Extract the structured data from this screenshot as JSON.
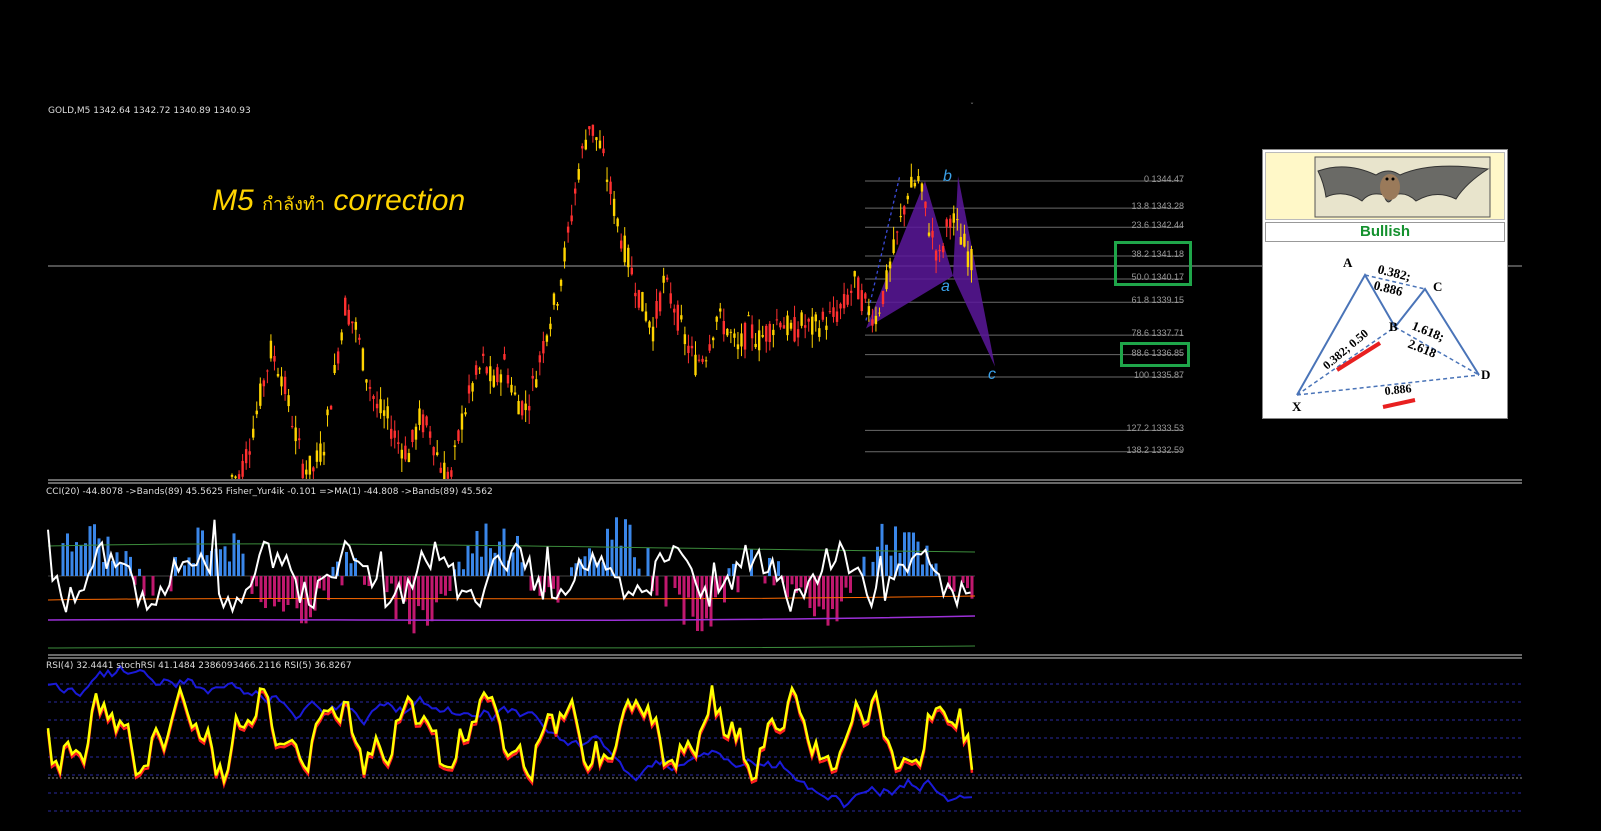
{
  "header": {
    "symbol_line": "GOLD,M5  1342.64 1342.72 1340.89 1340.93"
  },
  "annotation": {
    "timeframe": "M5",
    "thai_text": "กำลังทำ",
    "word": "correction"
  },
  "colors": {
    "bull_candle": "#ffd400",
    "bear_candle": "#ff3030",
    "pattern_fill": "#5a189a",
    "cci_up": "#3a86e8",
    "cci_down": "#c0186e",
    "fisher": "#ffffff",
    "rsi4": "#ffff00",
    "stochrsi": "#ff2020",
    "rsi5": "#1a1ad8",
    "box": "#1fa64a"
  },
  "waves": {
    "a": "a",
    "b": "b",
    "c": "c"
  },
  "fib_levels": [
    {
      "label": "0 1344.47",
      "price": 1344.47
    },
    {
      "label": "13.8 1343.28",
      "price": 1343.28
    },
    {
      "label": "23.6 1342.44",
      "price": 1342.44
    },
    {
      "label": "38.2 1341.18",
      "price": 1341.18
    },
    {
      "label": "50.0 1340.17",
      "price": 1340.17
    },
    {
      "label": "61.8 1339.15",
      "price": 1339.15
    },
    {
      "label": "78.6 1337.71",
      "price": 1337.71
    },
    {
      "label": "88.6 1336.85",
      "price": 1336.85
    },
    {
      "label": "100 1335.87",
      "price": 1335.87
    },
    {
      "label": "127.2 1333.53",
      "price": 1333.53
    },
    {
      "label": "138.2 1332.59",
      "price": 1332.59
    }
  ],
  "indicators": {
    "cci_header": "CCI(20) -44.8078  ->Bands(89) 45.5625  Fisher_Yur4ik -0.101  =>MA(1) -44.808  ->Bands(89) 45.562",
    "rsi_header": "RSI(4) 32.4441  stochRSI 41.1484 2386093466.2116  RSI(5) 36.8267"
  },
  "bat_pattern": {
    "title": "Bullish",
    "points": {
      "X": "X",
      "A": "A",
      "B": "B",
      "C": "C",
      "D": "D"
    },
    "ratios": {
      "ab_top": "0.382;",
      "ab_bottom": "0.886",
      "xb": "0.382; 0.50",
      "bc_top": "1.618;",
      "bc_bottom": "2.618",
      "xd": "0.886"
    }
  },
  "chart_data": {
    "type": "candlestick",
    "title": "",
    "xlabel": "",
    "ylabel": "",
    "ylim": [
      1330.5,
      1351.5
    ],
    "price_line": 1340.93,
    "candles_approx_close": [
      1331.5,
      1333,
      1335,
      1337,
      1336,
      1334,
      1332,
      1331.8,
      1333,
      1336,
      1339,
      1338,
      1336,
      1334.5,
      1334,
      1333,
      1332.5,
      1334,
      1333.5,
      1332,
      1331.5,
      1334,
      1335.5,
      1336.5,
      1335.5,
      1336.5,
      1335,
      1334.5,
      1336,
      1338,
      1339.5,
      1342,
      1345,
      1347,
      1346,
      1344,
      1342,
      1340.5,
      1339,
      1338,
      1340,
      1339,
      1337.5,
      1336.5,
      1337,
      1338.5,
      1338,
      1337,
      1338,
      1337.5,
      1338,
      1338.5,
      1337.8,
      1338.2,
      1338,
      1338.3,
      1338.5,
      1339,
      1340,
      1339,
      1338.5,
      1340,
      1342,
      1344,
      1344.5,
      1342.5,
      1341,
      1343,
      1342,
      1340.93
    ],
    "pattern_points": {
      "x": 1338.0,
      "a": 1340.3,
      "b": 1344.47,
      "c_projection": 1336.85
    },
    "boxed_levels": [
      "38.2 1341.18",
      "50.0 1340.17",
      "88.6 1336.85"
    ]
  }
}
